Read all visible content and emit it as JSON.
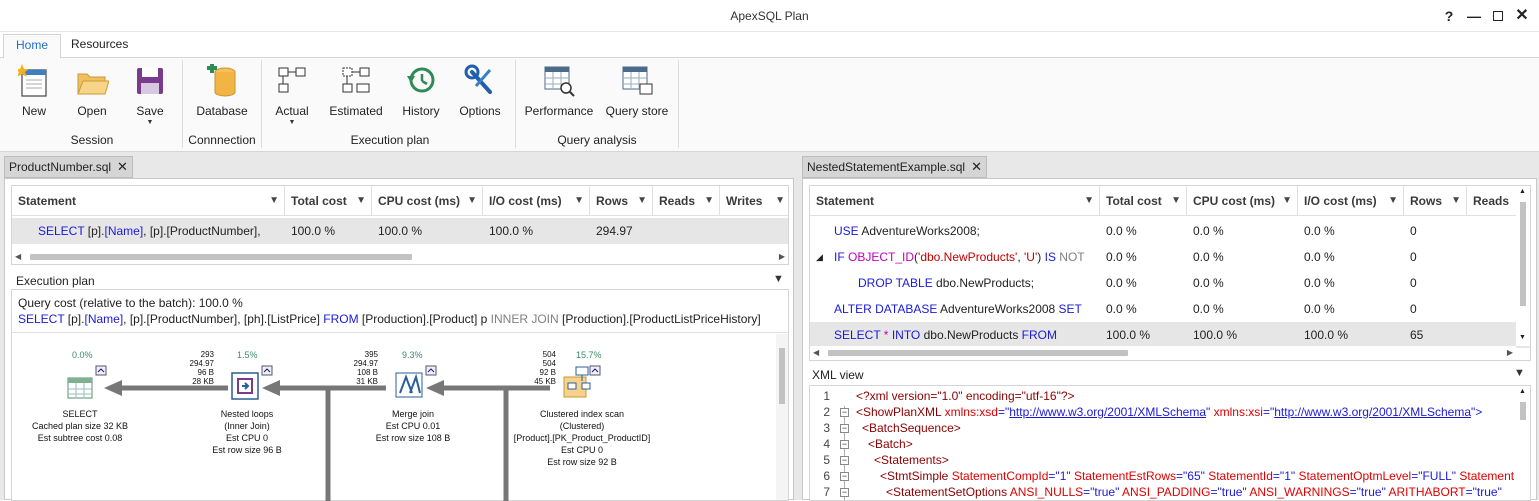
{
  "window": {
    "title": "ApexSQL Plan"
  },
  "ribbon": {
    "tabs": [
      "Home",
      "Resources"
    ],
    "buttons": {
      "new": "New",
      "open": "Open",
      "save": "Save",
      "database": "Database",
      "actual": "Actual",
      "estimated": "Estimated",
      "history": "History",
      "options": "Options",
      "performance": "Performance",
      "query_store": "Query store"
    },
    "groups": {
      "session": "Session",
      "connection": "Connnection",
      "execution_plan": "Execution plan",
      "query_analysis": "Query analysis"
    }
  },
  "left": {
    "tab": "ProductNumber.sql",
    "columns": [
      "Statement",
      "Total cost",
      "CPU cost (ms)",
      "I/O cost (ms)",
      "Rows",
      "Reads",
      "Writes"
    ],
    "row": {
      "stmt_kw": "SELECT",
      "stmt_p1": " [p].",
      "stmt_name": "[Name]",
      "stmt_p2": ", [p].[ProductNumber],",
      "total": "100.0 %",
      "cpu": "100.0 %",
      "io": "100.0 %",
      "rows": "294.97"
    },
    "exec_plan_title": "Execution plan",
    "query_cost": "Query cost (relative to the batch):  100.0 %",
    "sql": {
      "kw1": "SELECT",
      "a": " [p].",
      "name": "[Name]",
      "b": ", [p].[ProductNumber], [ph].[ListPrice] ",
      "kw2": "FROM",
      "c": " [Production].[Product] p ",
      "kw3": "INNER JOIN",
      "d": " [Production].[ProductListPriceHistory]"
    },
    "nodes": {
      "select": {
        "pct": "0.0%",
        "l1": "SELECT",
        "l2": "Cached plan size  32 KB",
        "l3": "Est subtree cost  0.08"
      },
      "nested": {
        "pct": "1.5%",
        "stats": [
          "293",
          "294.97",
          "96 B",
          "28 KB"
        ],
        "l1": "Nested loops",
        "l2": "(Inner Join)",
        "l3": "Est CPU  0",
        "l4": "Est row size  96 B"
      },
      "merge": {
        "pct": "9.3%",
        "stats": [
          "395",
          "294.97",
          "108 B",
          "31 KB"
        ],
        "l1": "Merge join",
        "l2": "Est CPU  0.01",
        "l3": "Est row size  108 B"
      },
      "scan": {
        "pct": "15.7%",
        "stats": [
          "504",
          "504",
          "92 B",
          "45 KB"
        ],
        "l1": "Clustered index scan",
        "l2": "(Clustered)",
        "l3": "[Product].[PK_Product_ProductID]",
        "l4": "Est CPU  0",
        "l5": "Est row size  92 B"
      }
    }
  },
  "right": {
    "tab": "NestedStatementExample.sql",
    "columns": [
      "Statement",
      "Total cost",
      "CPU cost (ms)",
      "I/O cost (ms)",
      "Rows",
      "Reads"
    ],
    "rows": [
      {
        "total": "0.0 %",
        "cpu": "0.0 %",
        "io": "0.0 %",
        "rows": "0"
      },
      {
        "total": "0.0 %",
        "cpu": "0.0 %",
        "io": "0.0 %",
        "rows": "0"
      },
      {
        "total": "0.0 %",
        "cpu": "0.0 %",
        "io": "0.0 %",
        "rows": "0"
      },
      {
        "total": "0.0 %",
        "cpu": "0.0 %",
        "io": "0.0 %",
        "rows": "0"
      },
      {
        "total": "100.0 %",
        "cpu": "100.0 %",
        "io": "100.0 %",
        "rows": "65"
      }
    ],
    "stmts": {
      "r0_kw": "USE",
      "r0_rest": " AdventureWorks2008;",
      "r1_kw": "IF",
      "r1_fn": " OBJECT_ID",
      "r1_a": "(",
      "r1_str": "'dbo.NewProducts'",
      "r1_b": ", ",
      "r1_str2": "'U'",
      "r1_c": ") ",
      "r1_kw2": "IS",
      "r1_kw3": " NOT",
      "r2_kw": "DROP TABLE",
      "r2_rest": " dbo.NewProducts;",
      "r3_kw": "ALTER DATABASE",
      "r3_rest": " AdventureWorks2008 ",
      "r3_kw2": "SET",
      "r4_kw": "SELECT",
      "r4_star": " *",
      "r4_kw2": " INTO",
      "r4_rest": " dbo.NewProducts ",
      "r4_kw3": "FROM"
    },
    "xml_title": "XML view",
    "xml": {
      "l1_decl": "<?xml version=\"1.0\" encoding=\"utf-16\"?>",
      "l2_tag": "<ShowPlanXML",
      "l2_a1": " xmlns:xsd",
      "l2_eq1": "=\"",
      "l2_u1": "http://www.w3.org/2001/XMLSchema",
      "l2_q1": "\"",
      "l2_a2": " xmlns:xsi",
      "l2_eq2": "=\"",
      "l2_u2": "http://www.w3.org/2001/XMLSchema",
      "l2_q2": "\">",
      "l3": "<BatchSequence>",
      "l4": "<Batch>",
      "l5": "<Statements>",
      "l6_tag": "<StmtSimple",
      "l6_a1": " StatementCompId",
      "l6_v1": "=\"1\"",
      "l6_a2": " StatementEstRows",
      "l6_v2": "=\"65\"",
      "l6_a3": " StatementId",
      "l6_v3": "=\"1\"",
      "l6_a4": " StatementOptmLevel",
      "l6_v4": "=\"FULL\"",
      "l6_a5": " Statement",
      "l7_tag": "<StatementSetOptions",
      "l7_a1": " ANSI_NULLS",
      "l7_v1": "=\"true\"",
      "l7_a2": " ANSI_PADDING",
      "l7_v2": "=\"true\"",
      "l7_a3": " ANSI_WARNINGS",
      "l7_v3": "=\"true\"",
      "l7_a4": " ARITHABORT",
      "l7_v4": "=\"true\""
    }
  }
}
